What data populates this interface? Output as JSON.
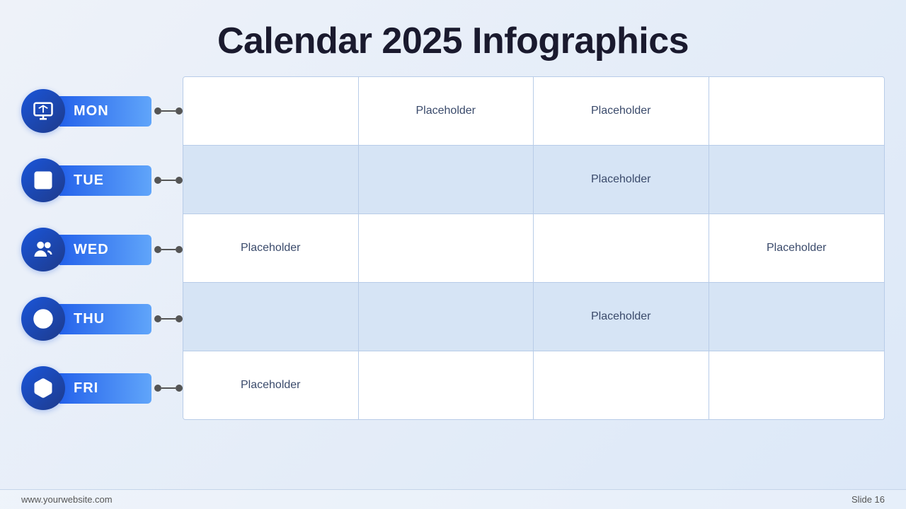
{
  "header": {
    "title": "Calendar 2025 Infographics"
  },
  "days": [
    {
      "id": "mon",
      "label": "MON",
      "icon": "presentation"
    },
    {
      "id": "tue",
      "label": "TUE",
      "icon": "list"
    },
    {
      "id": "wed",
      "label": "WED",
      "icon": "group"
    },
    {
      "id": "thu",
      "label": "THU",
      "icon": "target"
    },
    {
      "id": "fri",
      "label": "FRI",
      "icon": "box"
    }
  ],
  "grid": [
    [
      "",
      "Placeholder",
      "Placeholder",
      ""
    ],
    [
      "",
      "",
      "Placeholder",
      ""
    ],
    [
      "Placeholder",
      "",
      "",
      "Placeholder"
    ],
    [
      "",
      "",
      "Placeholder",
      ""
    ],
    [
      "Placeholder",
      "",
      "",
      ""
    ]
  ],
  "footer": {
    "website": "www.yourwebsite.com",
    "slide_label": "Slide 16"
  }
}
